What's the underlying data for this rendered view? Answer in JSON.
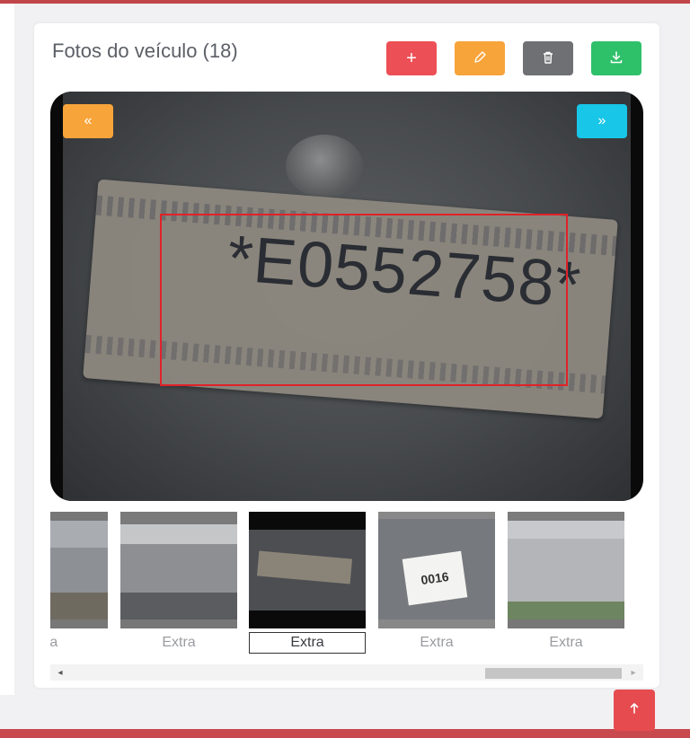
{
  "card": {
    "title": "Fotos do veículo (18)"
  },
  "toolbar": {
    "add_label": "+",
    "edit_icon": "pencil-icon",
    "delete_icon": "trash-icon",
    "download_icon": "download-icon"
  },
  "viewer": {
    "prev_label": "«",
    "next_label": "»",
    "plate_text": "*E0552758*"
  },
  "thumbnails": [
    {
      "caption": "tra",
      "selected": false
    },
    {
      "caption": "Extra",
      "selected": false
    },
    {
      "caption": "Extra",
      "selected": true
    },
    {
      "caption": "Extra",
      "selected": false,
      "card_text": "0016"
    },
    {
      "caption": "Extra",
      "selected": false
    }
  ],
  "scrollbar": {
    "left_arrow": "◂",
    "right_arrow": "▸"
  },
  "colors": {
    "accent_red": "#ec4f55",
    "edit_orange": "#f7a43a",
    "delete_gray": "#6e7073",
    "download_green": "#2fc06a",
    "next_cyan": "#18c6e8",
    "detection_box": "#e0222a"
  }
}
